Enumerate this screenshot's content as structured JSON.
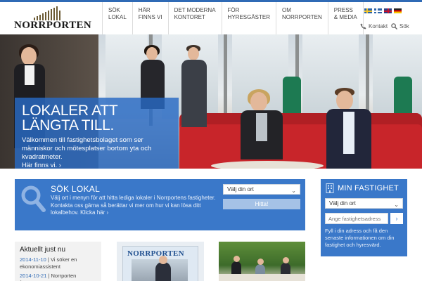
{
  "brand": {
    "name": "NORRPORTEN"
  },
  "nav": {
    "items": [
      {
        "line1": "SÖK",
        "line2": "LOKAL"
      },
      {
        "line1": "HÄR",
        "line2": "FINNS VI"
      },
      {
        "line1": "DET MODERNA",
        "line2": "KONTORET"
      },
      {
        "line1": "FÖR",
        "line2": "HYRESGÄSTER"
      },
      {
        "line1": "OM",
        "line2": "NORRPORTEN"
      },
      {
        "line1": "PRESS",
        "line2": "& MEDIA"
      }
    ]
  },
  "languages": [
    "se-flag",
    "fi-flag",
    "gb-flag",
    "de-flag"
  ],
  "utility": {
    "kontakt": "Kontakt",
    "sok": "Sök"
  },
  "hero": {
    "title_line1": "LOKALER ATT",
    "title_line2": "LÄNGTA TILL.",
    "text": "Välkommen till fastighetsbolaget som ser människor och mötesplatser bortom yta och kvadratmeter.",
    "link": "Här finns vi."
  },
  "search": {
    "title": "SÖK LOKAL",
    "text": "Välj ort i menyn för att hitta lediga lokaler i Norrportens fastigheter.",
    "text2": "Kontakta oss gärna så berättar vi mer om hur vi kan lösa ditt lokalbehov.",
    "link": "Klicka här",
    "select_value": "Välj din ort",
    "button": "Hitta!"
  },
  "min_fastighet": {
    "title": "MIN FASTIGHET",
    "select_value": "Välj din ort",
    "input_placeholder": "Ange fastighetsadress",
    "text": "Fyll i din adress och få den senaste informationen om din fastighet och hyresvärd."
  },
  "news": {
    "title": "Aktuellt just nu",
    "items": [
      {
        "date": "2014-11-10",
        "text": "Vi söker en ekonomiassistent"
      },
      {
        "date": "2014-10-21",
        "text": "Norrporten förvärvar"
      }
    ]
  },
  "magazine": {
    "title": "NORRPORTEN"
  },
  "colors": {
    "accent": "#3a78c9",
    "hero_box": "#286ac4",
    "sofa": "#c8252a"
  },
  "icons": {
    "contact": "phone-icon",
    "search": "search-icon",
    "building": "building-icon"
  }
}
